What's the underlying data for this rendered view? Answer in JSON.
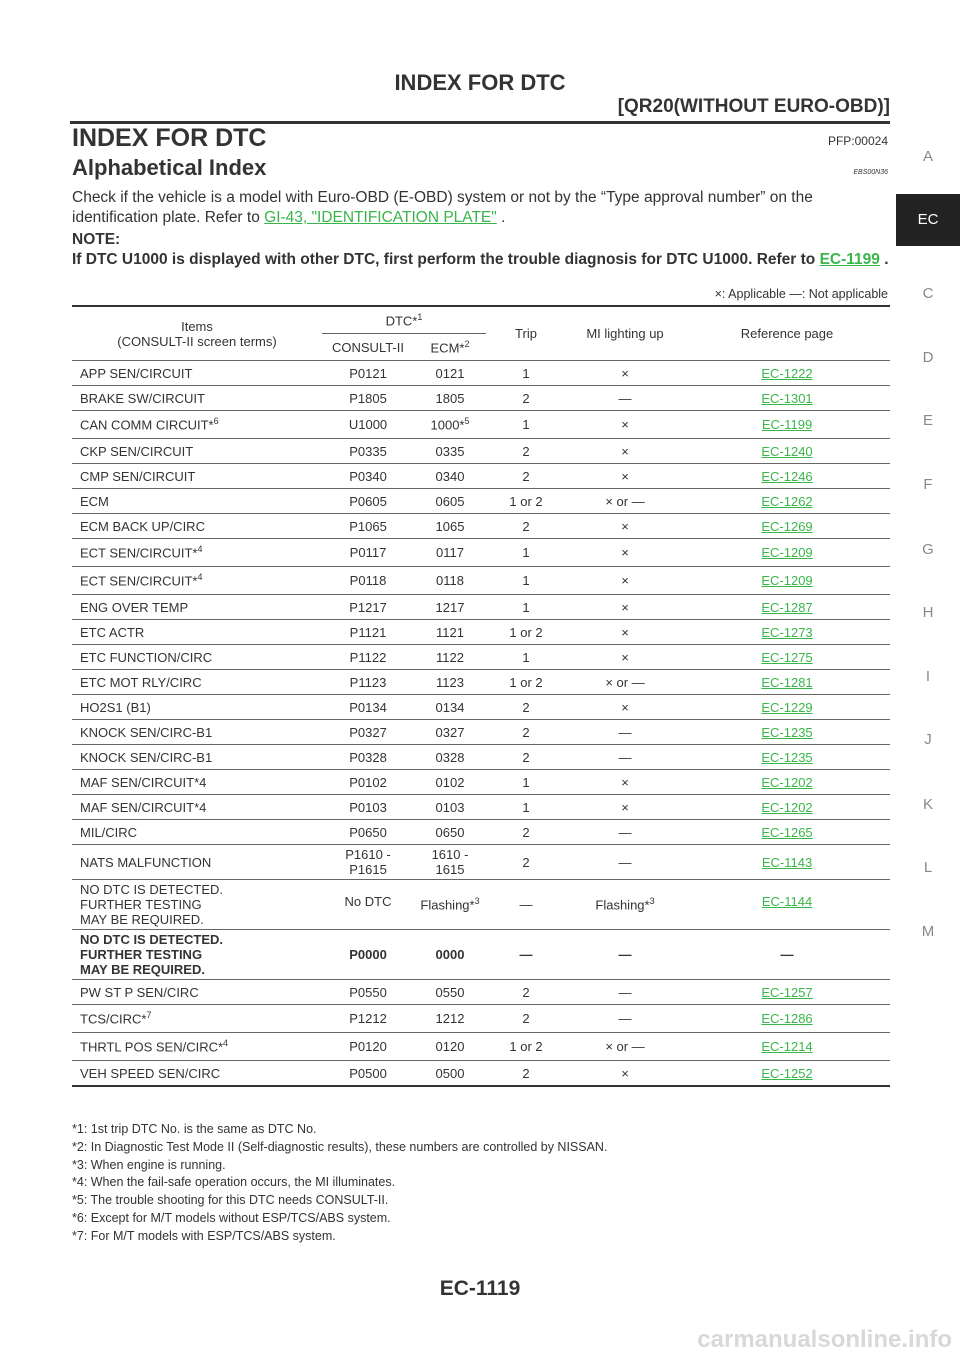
{
  "header": {
    "title": "INDEX FOR DTC",
    "subtitle": "[QR20(WITHOUT EURO-OBD)]"
  },
  "section": {
    "title": "INDEX FOR DTC",
    "pfp": "PFP:00024",
    "subtitle": "Alphabetical Index",
    "ebs": "EBS00N36"
  },
  "intro": {
    "text_before": "Check if the vehicle is a model with Euro-OBD (E-OBD) system or not by the “Type approval number” on the identification plate. Refer to ",
    "link": "GI-43, \"IDENTIFICATION PLATE\"",
    "text_after": " ."
  },
  "note": {
    "heading": "NOTE:",
    "text_before": "If DTC U1000 is displayed with other DTC, first perform the trouble diagnosis for DTC U1000. Refer to ",
    "link": "EC-1199",
    "text_after": " ."
  },
  "legend": "×: Applicable —: Not applicable",
  "table": {
    "headers": {
      "items": "Items",
      "items_sub": "(CONSULT-II screen terms)",
      "dtc": "DTC*",
      "dtc_sup": "1",
      "consult": "CONSULT-II",
      "ecm": "ECM*",
      "ecm_sup": "2",
      "trip": "Trip",
      "mi": "MI lighting up",
      "ref": "Reference page"
    },
    "rows": [
      {
        "item": "APP SEN/CIRCUIT",
        "sup": "",
        "consult": "P0121",
        "ecm": "0121",
        "ecm_sup": "",
        "trip": "1",
        "mi": "×",
        "ref": "EC-1222"
      },
      {
        "item": "BRAKE SW/CIRCUIT",
        "sup": "",
        "consult": "P1805",
        "ecm": "1805",
        "ecm_sup": "",
        "trip": "2",
        "mi": "—",
        "ref": "EC-1301"
      },
      {
        "item": "CAN COMM CIRCUIT*",
        "sup": "6",
        "consult": "U1000",
        "ecm": "1000*",
        "ecm_sup": "5",
        "trip": "1",
        "mi": "×",
        "ref": "EC-1199"
      },
      {
        "item": "CKP SEN/CIRCUIT",
        "sup": "",
        "consult": "P0335",
        "ecm": "0335",
        "ecm_sup": "",
        "trip": "2",
        "mi": "×",
        "ref": "EC-1240"
      },
      {
        "item": "CMP SEN/CIRCUIT",
        "sup": "",
        "consult": "P0340",
        "ecm": "0340",
        "ecm_sup": "",
        "trip": "2",
        "mi": "×",
        "ref": "EC-1246"
      },
      {
        "item": "ECM",
        "sup": "",
        "consult": "P0605",
        "ecm": "0605",
        "ecm_sup": "",
        "trip": "1 or 2",
        "mi": "× or —",
        "ref": "EC-1262"
      },
      {
        "item": "ECM BACK UP/CIRC",
        "sup": "",
        "consult": "P1065",
        "ecm": "1065",
        "ecm_sup": "",
        "trip": "2",
        "mi": "×",
        "ref": "EC-1269"
      },
      {
        "item": "ECT SEN/CIRCUIT*",
        "sup": "4",
        "consult": "P0117",
        "ecm": "0117",
        "ecm_sup": "",
        "trip": "1",
        "mi": "×",
        "ref": "EC-1209"
      },
      {
        "item": "ECT SEN/CIRCUIT*",
        "sup": "4",
        "consult": "P0118",
        "ecm": "0118",
        "ecm_sup": "",
        "trip": "1",
        "mi": "×",
        "ref": "EC-1209"
      },
      {
        "item": "ENG OVER TEMP",
        "sup": "",
        "consult": "P1217",
        "ecm": "1217",
        "ecm_sup": "",
        "trip": "1",
        "mi": "×",
        "ref": "EC-1287"
      },
      {
        "item": "ETC ACTR",
        "sup": "",
        "consult": "P1121",
        "ecm": "1121",
        "ecm_sup": "",
        "trip": "1 or 2",
        "mi": "×",
        "ref": "EC-1273"
      },
      {
        "item": "ETC FUNCTION/CIRC",
        "sup": "",
        "consult": "P1122",
        "ecm": "1122",
        "ecm_sup": "",
        "trip": "1",
        "mi": "×",
        "ref": "EC-1275"
      },
      {
        "item": "ETC MOT RLY/CIRC",
        "sup": "",
        "consult": "P1123",
        "ecm": "1123",
        "ecm_sup": "",
        "trip": "1 or 2",
        "mi": "× or —",
        "ref": "EC-1281"
      },
      {
        "item": "HO2S1 (B1)",
        "sup": "",
        "consult": "P0134",
        "ecm": "0134",
        "ecm_sup": "",
        "trip": "2",
        "mi": "×",
        "ref": "EC-1229"
      },
      {
        "item": "KNOCK SEN/CIRC-B1",
        "sup": "",
        "consult": "P0327",
        "ecm": "0327",
        "ecm_sup": "",
        "trip": "2",
        "mi": "—",
        "ref": "EC-1235"
      },
      {
        "item": "KNOCK SEN/CIRC-B1",
        "sup": "",
        "consult": "P0328",
        "ecm": "0328",
        "ecm_sup": "",
        "trip": "2",
        "mi": "—",
        "ref": "EC-1235"
      },
      {
        "item": "MAF SEN/CIRCUIT*4",
        "sup": "",
        "consult": "P0102",
        "ecm": "0102",
        "ecm_sup": "",
        "trip": "1",
        "mi": "×",
        "ref": "EC-1202"
      },
      {
        "item": "MAF SEN/CIRCUIT*4",
        "sup": "",
        "consult": "P0103",
        "ecm": "0103",
        "ecm_sup": "",
        "trip": "1",
        "mi": "×",
        "ref": "EC-1202"
      },
      {
        "item": "MIL/CIRC",
        "sup": "",
        "consult": "P0650",
        "ecm": "0650",
        "ecm_sup": "",
        "trip": "2",
        "mi": "—",
        "ref": "EC-1265"
      }
    ],
    "nats": {
      "item": "NATS MALFUNCTION",
      "consult1": "P1610 -",
      "consult2": "P1615",
      "ecm": "1610 - 1615",
      "trip": "2",
      "mi": "—",
      "ref": "EC-1143"
    },
    "nodtc": {
      "line1": "NO DTC IS DETECTED.",
      "line2": "FURTHER TESTING",
      "line3": "MAY BE REQUIRED.",
      "consult": "No DTC",
      "ecm": "Flashing*",
      "ecm_sup": "3",
      "trip": "—",
      "mi": "Flashing*",
      "mi_sup": "3",
      "ref": "EC-1144"
    },
    "p0000": {
      "line1": "NO DTC IS DETECTED.",
      "line2": "FURTHER TESTING",
      "line3": "MAY BE REQUIRED.",
      "consult": "P0000",
      "ecm": "0000",
      "trip": "—",
      "mi": "—",
      "ref": "—"
    },
    "rows2": [
      {
        "item": "PW ST P SEN/CIRC",
        "sup": "",
        "consult": "P0550",
        "ecm": "0550",
        "trip": "2",
        "mi": "—",
        "ref": "EC-1257"
      },
      {
        "item": "TCS/CIRC*",
        "sup": "7",
        "consult": "P1212",
        "ecm": "1212",
        "trip": "2",
        "mi": "—",
        "ref": "EC-1286"
      },
      {
        "item": "THRTL POS SEN/CIRC*",
        "sup": "4",
        "consult": "P0120",
        "ecm": "0120",
        "trip": "1 or 2",
        "mi": "× or —",
        "ref": "EC-1214"
      },
      {
        "item": "VEH SPEED SEN/CIRC",
        "sup": "",
        "consult": "P0500",
        "ecm": "0500",
        "trip": "2",
        "mi": "×",
        "ref": "EC-1252"
      }
    ]
  },
  "footnotes": [
    "*1: 1st trip DTC No. is the same as DTC No.",
    "*2: In Diagnostic Test Mode II (Self-diagnostic results), these numbers are controlled by NISSAN.",
    "*3: When engine is running.",
    "*4: When the fail-safe operation occurs, the MI illuminates.",
    "*5: The trouble shooting for this DTC needs CONSULT-II.",
    "*6: Except for M/T models without ESP/TCS/ABS system.",
    "*7: For M/T models with ESP/TCS/ABS system."
  ],
  "page_number": "EC-1119",
  "watermark": "carmanualsonline.info",
  "side_tabs": [
    "A",
    "EC",
    "C",
    "D",
    "E",
    "F",
    "G",
    "H",
    "I",
    "J",
    "K",
    "L",
    "M"
  ],
  "active_tab": "EC",
  "colors": {
    "link": "#39b54a",
    "active_tab_bg": "#222222"
  }
}
